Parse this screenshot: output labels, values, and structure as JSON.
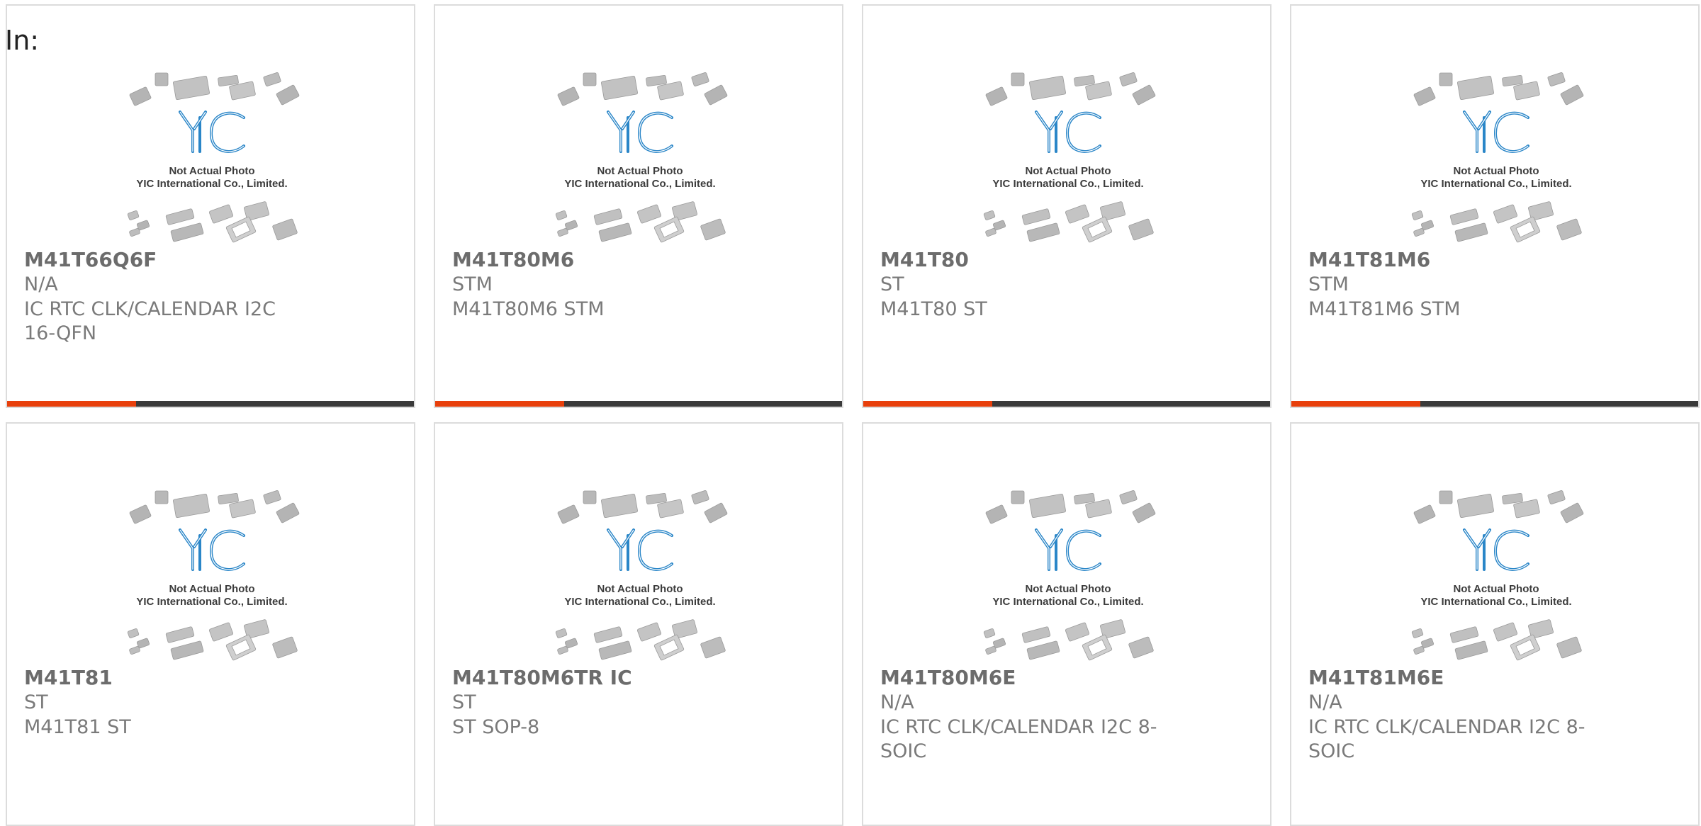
{
  "header": {
    "label": "In:"
  },
  "placeholder_image": {
    "logo_text": "YIC",
    "line1": "Not Actual Photo",
    "line2": "YIC International Co., Limited.",
    "logo_color": "#2a86c8"
  },
  "colors": {
    "accent": "#e8400c",
    "bar": "#3a3a3a",
    "border": "#dcdcdc"
  },
  "products": [
    {
      "name": "M41T66Q6F",
      "brand": "N/A",
      "desc": "IC RTC CLK/CALENDAR I2C 16-QFN"
    },
    {
      "name": "M41T80M6",
      "brand": "STM",
      "desc": "M41T80M6 STM"
    },
    {
      "name": "M41T80",
      "brand": "ST",
      "desc": "M41T80 ST"
    },
    {
      "name": "M41T81M6",
      "brand": "STM",
      "desc": "M41T81M6 STM"
    },
    {
      "name": "M41T81",
      "brand": "ST",
      "desc": "M41T81 ST"
    },
    {
      "name": "M41T80M6TR IC",
      "brand": "ST",
      "desc": "ST SOP-8"
    },
    {
      "name": "M41T80M6E",
      "brand": "N/A",
      "desc": "IC RTC CLK/CALENDAR I2C 8-SOIC"
    },
    {
      "name": "M41T81M6E",
      "brand": "N/A",
      "desc": "IC RTC CLK/CALENDAR I2C 8-SOIC"
    }
  ]
}
